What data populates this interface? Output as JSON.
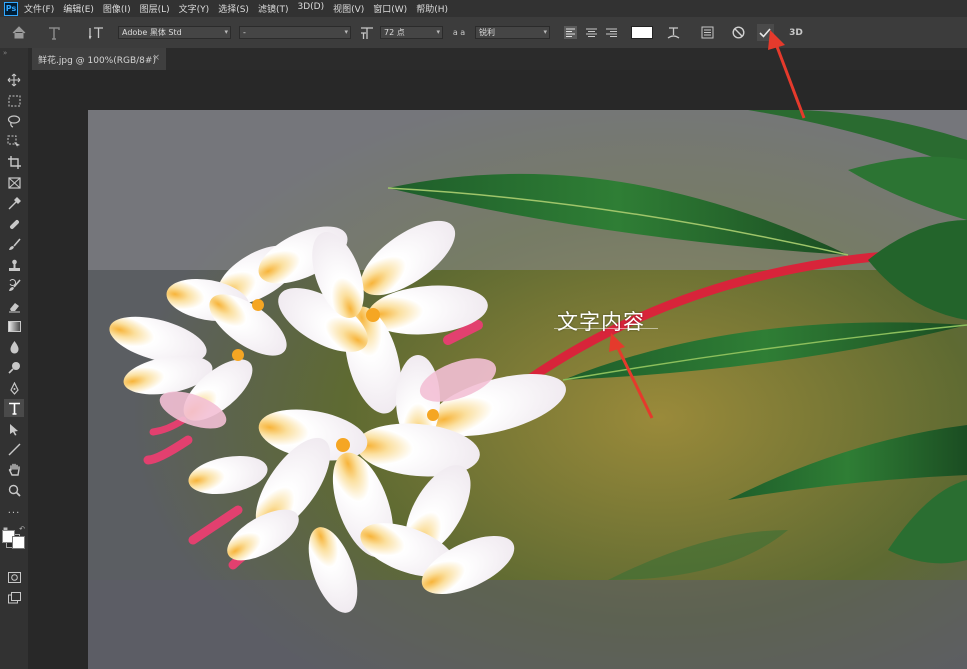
{
  "app": {
    "logo": "Ps"
  },
  "menu": [
    "文件(F)",
    "编辑(E)",
    "图像(I)",
    "图层(L)",
    "文字(Y)",
    "选择(S)",
    "滤镜(T)",
    "3D(D)",
    "视图(V)",
    "窗口(W)",
    "帮助(H)"
  ],
  "options_bar": {
    "font_family": "Adobe 黑体 Std",
    "font_style": "-",
    "font_size": "72 点",
    "aa_label": "a a",
    "antialias": "锐利",
    "text_color": "#ffffff",
    "threed_label": "3D"
  },
  "document_tab": {
    "title": "鲜花.jpg @ 100%(RGB/8#)",
    "close": "×"
  },
  "canvas": {
    "text_content": "文字内容"
  },
  "colors": {
    "accent": "#31a8ff",
    "arrow": "#e53a2c"
  }
}
